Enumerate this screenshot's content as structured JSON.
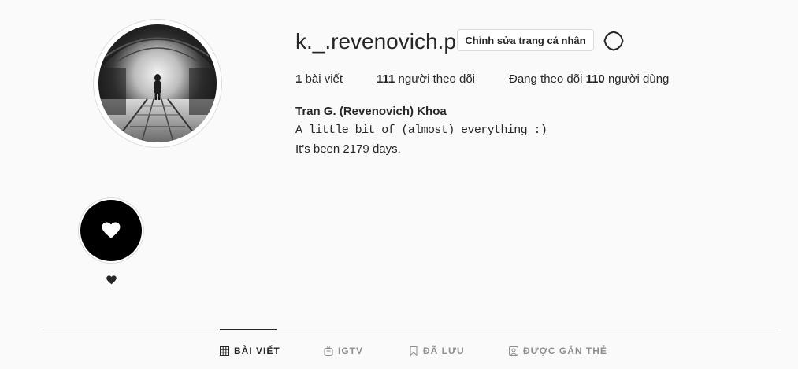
{
  "profile": {
    "username": "k._.revenovich.p",
    "edit_label": "Chỉnh sửa trang cá nhân",
    "full_name": "Tran G. (Revenovich) Khoa",
    "bio_line1": "A little bit of (almost) everything :)",
    "bio_line2": "It's been 2179 days."
  },
  "stats": {
    "posts_count": "1",
    "posts_label": "bài viết",
    "followers_count": "111",
    "followers_label": "người theo dõi",
    "following_prefix": "Đang theo dõi",
    "following_count": "110",
    "following_suffix": "người dùng"
  },
  "highlight": {
    "label": "♥",
    "icon": "heart-icon"
  },
  "tabs": [
    {
      "label": "BÀI VIẾT",
      "icon": "grid-icon",
      "active": true
    },
    {
      "label": "IGTV",
      "icon": "igtv-icon",
      "active": false
    },
    {
      "label": "ĐÃ LƯU",
      "icon": "bookmark-icon",
      "active": false
    },
    {
      "label": "ĐƯỢC GẮN THẺ",
      "icon": "tagged-icon",
      "active": false
    }
  ],
  "colors": {
    "background": "#fafafa",
    "text": "#262626",
    "muted": "#8e8e8e",
    "border": "#dbdbdb"
  }
}
